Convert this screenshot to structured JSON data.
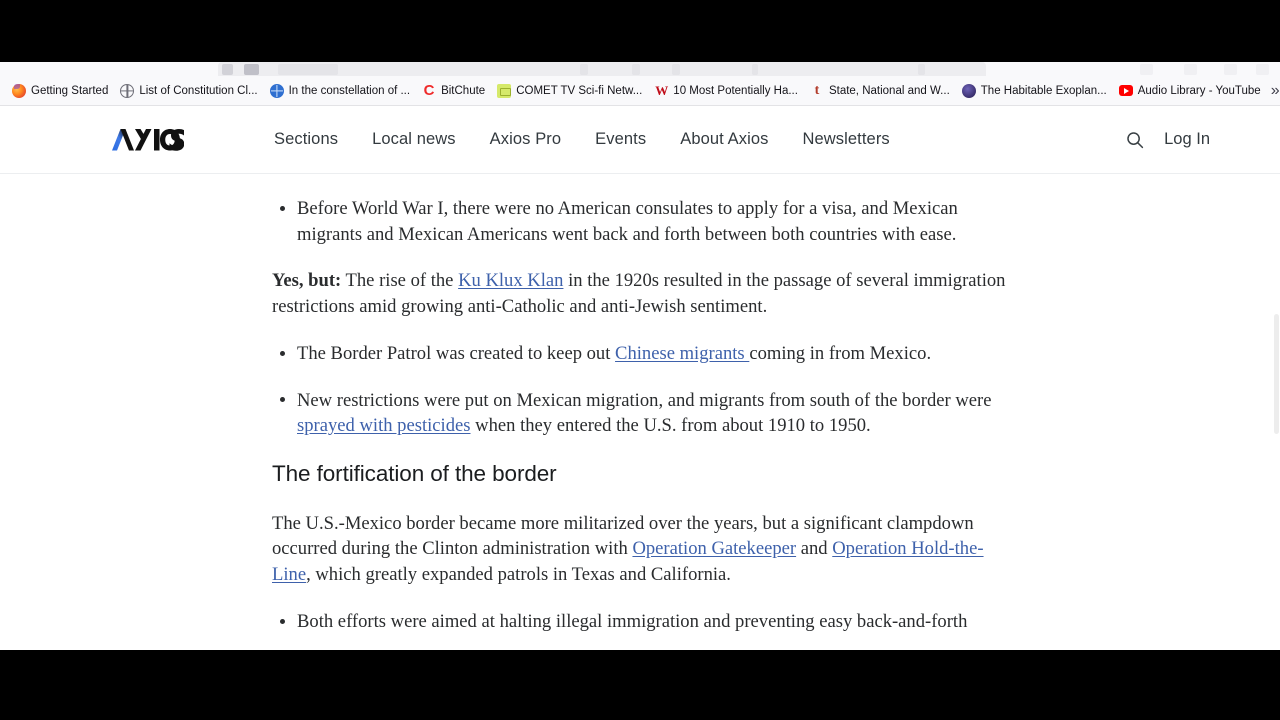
{
  "browser": {
    "bookmarks_bar": {
      "overflow_glyph": "»",
      "items": [
        {
          "label": "Getting Started",
          "icon": "firefox-icon"
        },
        {
          "label": "List of Constitution Cl...",
          "icon": "globe-gray-icon"
        },
        {
          "label": "In the constellation of ...",
          "icon": "globe-blue-icon"
        },
        {
          "label": "BitChute",
          "icon": "bitchute-icon",
          "glyph": "C"
        },
        {
          "label": "COMET TV Sci-fi Netw...",
          "icon": "comet-tv-icon"
        },
        {
          "label": "10 Most Potentially Ha...",
          "icon": "w-icon",
          "glyph": "W"
        },
        {
          "label": "State, National and W...",
          "icon": "t-icon",
          "glyph": "t"
        },
        {
          "label": "The Habitable Exoplan...",
          "icon": "exoplanet-icon"
        },
        {
          "label": "Audio Library - YouTube",
          "icon": "youtube-icon"
        }
      ]
    }
  },
  "site": {
    "brand": {
      "name": "AXIOS",
      "accent_color": "#2b6ce0",
      "text_color": "#0c0c0c"
    },
    "nav": [
      {
        "label": "Sections"
      },
      {
        "label": "Local news"
      },
      {
        "label": "Axios Pro"
      },
      {
        "label": "Events"
      },
      {
        "label": "About Axios"
      },
      {
        "label": "Newsletters"
      }
    ],
    "actions": {
      "search_icon": "search-icon",
      "login_label": "Log In"
    }
  },
  "article": {
    "link_color": "#3e61ab",
    "blocks": [
      {
        "type": "bullet",
        "runs": [
          {
            "text": "Before World War I, there were no American consulates to apply for a visa, and Mexican migrants and Mexican Americans went back and forth between both countries with ease."
          }
        ]
      },
      {
        "type": "paragraph",
        "runs": [
          {
            "text": "Yes, but:",
            "style": "bold"
          },
          {
            "text": " The rise of the "
          },
          {
            "text": "Ku Klux Klan",
            "style": "link"
          },
          {
            "text": " in the 1920s resulted in the passage of several immigration restrictions amid growing anti-Catholic and anti-Jewish sentiment."
          }
        ]
      },
      {
        "type": "bullet",
        "runs": [
          {
            "text": "The Border Patrol was created to keep out "
          },
          {
            "text": "Chinese migrants ",
            "style": "link"
          },
          {
            "text": "coming in from Mexico."
          }
        ]
      },
      {
        "type": "bullet",
        "runs": [
          {
            "text": "New restrictions were put on Mexican migration, and migrants from south of the border were "
          },
          {
            "text": "sprayed with pesticides",
            "style": "link"
          },
          {
            "text": " when they entered the U.S. from about 1910 to 1950."
          }
        ]
      },
      {
        "type": "heading",
        "runs": [
          {
            "text": "The fortification of the border"
          }
        ]
      },
      {
        "type": "paragraph",
        "runs": [
          {
            "text": "The U.S.-Mexico border became more militarized over the years, but a significant clampdown occurred during the Clinton administration with "
          },
          {
            "text": "Operation Gatekeeper",
            "style": "link"
          },
          {
            "text": " and "
          },
          {
            "text": "Operation Hold-the-Line",
            "style": "link"
          },
          {
            "text": ", which greatly expanded patrols in Texas and California."
          }
        ]
      },
      {
        "type": "bullet",
        "runs": [
          {
            "text": "Both efforts were aimed at halting illegal immigration and preventing easy back-and-forth"
          }
        ]
      }
    ]
  }
}
